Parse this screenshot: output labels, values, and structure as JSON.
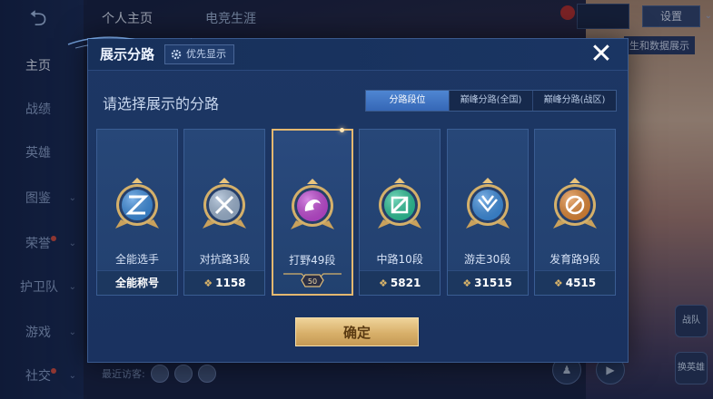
{
  "background": {
    "nav": [
      "主页",
      "战绩",
      "英雄",
      "图鉴",
      "荣誉",
      "护卫队",
      "游戏",
      "社交"
    ],
    "top_tabs": [
      "个人主页",
      "电竞生涯"
    ],
    "settings_label": "设置",
    "link_label": "生和数据展示",
    "visitors_label": "最近访客:",
    "side_buttons": [
      "战队",
      "换英雄"
    ]
  },
  "modal": {
    "title": "展示分路",
    "priority_label": "优先显示",
    "close_glyph": "✕",
    "prompt": "请选择展示的分路",
    "tabs": [
      "分路段位",
      "巅峰分路(全国)",
      "巅峰分路(战区)"
    ],
    "active_tab": 0,
    "cards": [
      {
        "label": "全能选手",
        "footer": "全能称号",
        "badge_color": "#3f8fe0",
        "emblem": "all-round"
      },
      {
        "label": "对抗路3段",
        "footer": "1158",
        "badge_color": "#9fb6d2",
        "emblem": "clash"
      },
      {
        "label": "打野49段",
        "footer": "",
        "level": "50",
        "badge_color": "#c24bd6",
        "emblem": "jungle",
        "selected": true
      },
      {
        "label": "中路10段",
        "footer": "5821",
        "badge_color": "#2fc49a",
        "emblem": "mid"
      },
      {
        "label": "游走30段",
        "footer": "31515",
        "badge_color": "#3f8fe0",
        "emblem": "roam"
      },
      {
        "label": "发育路9段",
        "footer": "4515",
        "badge_color": "#e28a3a",
        "emblem": "farm"
      }
    ],
    "confirm_label": "确定"
  }
}
